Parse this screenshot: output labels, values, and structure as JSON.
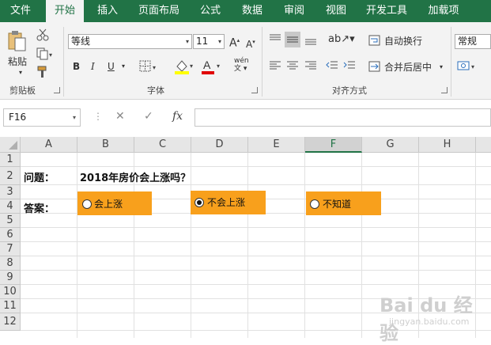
{
  "tabs": [
    {
      "label": "文件",
      "active": false
    },
    {
      "label": "开始",
      "active": true
    },
    {
      "label": "插入",
      "active": false
    },
    {
      "label": "页面布局",
      "active": false
    },
    {
      "label": "公式",
      "active": false
    },
    {
      "label": "数据",
      "active": false
    },
    {
      "label": "审阅",
      "active": false
    },
    {
      "label": "视图",
      "active": false
    },
    {
      "label": "开发工具",
      "active": false
    },
    {
      "label": "加载项",
      "active": false
    }
  ],
  "clipboard": {
    "group_label": "剪贴板",
    "paste_label": "粘贴"
  },
  "font": {
    "group_label": "字体",
    "name": "等线",
    "size": "11",
    "bold": "B",
    "italic": "I",
    "underline": "U",
    "phonetic": "wén"
  },
  "alignment": {
    "group_label": "对齐方式",
    "wrap_text": "自动换行",
    "merge_center": "合并后居中"
  },
  "number": {
    "format": "常规"
  },
  "formula_bar": {
    "name_box": "F16",
    "fx": "fx",
    "cancel": "✕",
    "confirm": "✓",
    "value": ""
  },
  "columns": [
    "A",
    "B",
    "C",
    "D",
    "E",
    "F",
    "G",
    "H"
  ],
  "selected_column": "F",
  "rows": [
    "1",
    "2",
    "3",
    "4",
    "5",
    "6",
    "7",
    "8",
    "9",
    "10",
    "11",
    "12"
  ],
  "cells": {
    "A2": "问题：",
    "B2": "2018年房价会上涨吗？",
    "A4": "答案："
  },
  "options": [
    {
      "label": "会上涨",
      "selected": false
    },
    {
      "label": "不会上涨",
      "selected": true
    },
    {
      "label": "不知道",
      "selected": false
    }
  ],
  "colors": {
    "accent": "#217346",
    "option_bg": "#f8a01c"
  },
  "watermark": {
    "text": "Bai du 经验",
    "sub": "jingyan.baidu.com"
  }
}
